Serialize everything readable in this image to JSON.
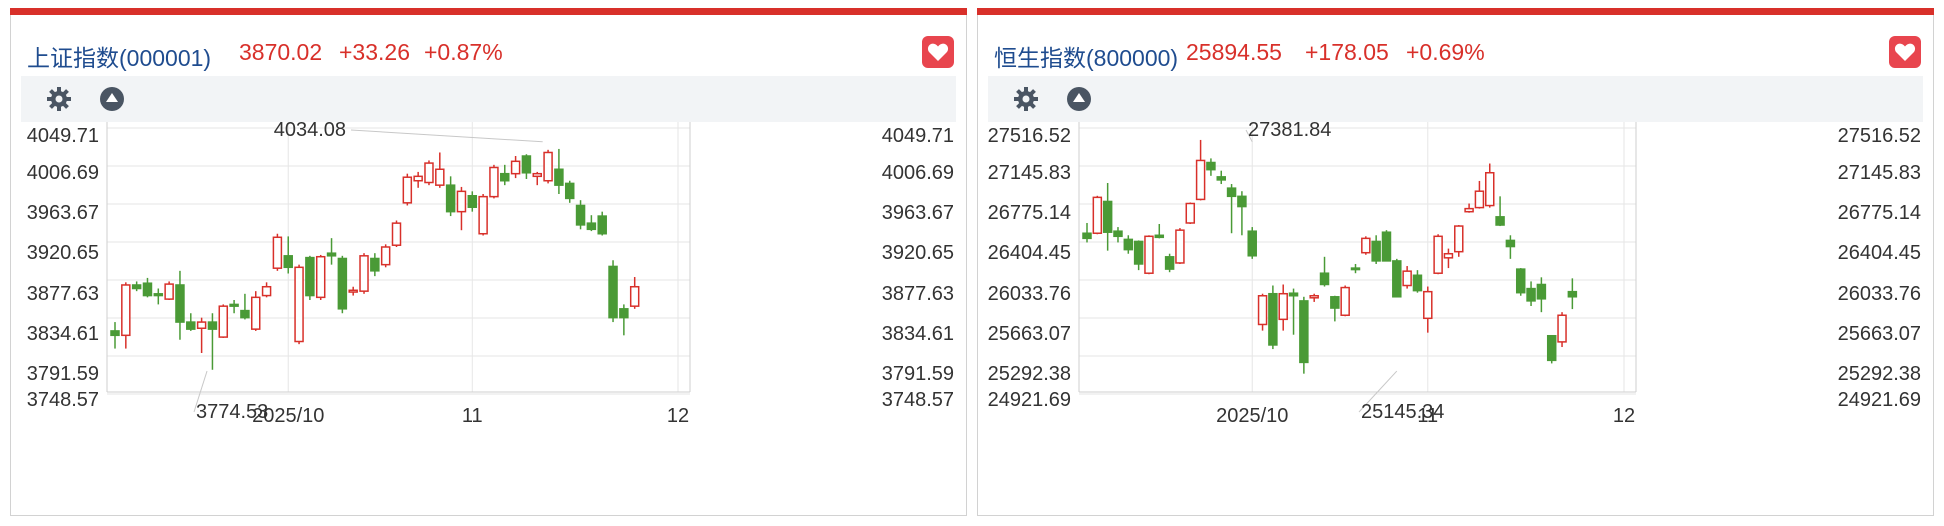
{
  "panels": [
    {
      "title": "上证指数(000001)",
      "price": "3870.02",
      "change": "+33.26",
      "change_pct": "+0.87%",
      "colors": {
        "up": "#d8302a",
        "down": "#4a9a36",
        "title": "#1f4c8f"
      },
      "icons": [
        "gear-icon",
        "triangle-up-icon",
        "heart-icon"
      ]
    },
    {
      "title": "恒生指数(800000)",
      "price": "25894.55",
      "change": "+178.05",
      "change_pct": "+0.69%",
      "colors": {
        "up": "#d8302a",
        "down": "#4a9a36",
        "title": "#1f4c8f"
      },
      "icons": [
        "gear-icon",
        "triangle-up-icon",
        "heart-icon"
      ]
    }
  ],
  "chart_data": [
    {
      "type": "candlestick",
      "ytick_labels": [
        "4049.71",
        "4006.69",
        "3963.67",
        "3920.65",
        "3877.63",
        "3834.61",
        "3791.59",
        "3748.57"
      ],
      "ylim": [
        3748.57,
        4049.71
      ],
      "xtick_labels": [
        "2025/10",
        "11",
        "12"
      ],
      "xticks": [
        16,
        33,
        52
      ],
      "xlim": [
        0,
        52
      ],
      "grid": true,
      "annotations": [
        {
          "text": "4034.08",
          "x": 39.5,
          "y": 4034.08
        },
        {
          "text": "3774.53",
          "x": 8.5,
          "y": 3774.53
        }
      ],
      "candles": [
        {
          "x": 0,
          "o": 3820,
          "h": 3830,
          "l": 3800,
          "c": 3815
        },
        {
          "x": 1,
          "o": 3815,
          "h": 3875,
          "l": 3800,
          "c": 3872
        },
        {
          "x": 2,
          "o": 3872,
          "h": 3876,
          "l": 3865,
          "c": 3868
        },
        {
          "x": 3,
          "o": 3874,
          "h": 3880,
          "l": 3858,
          "c": 3860
        },
        {
          "x": 4,
          "o": 3862,
          "h": 3868,
          "l": 3850,
          "c": 3860
        },
        {
          "x": 5,
          "o": 3856,
          "h": 3876,
          "l": 3855,
          "c": 3873
        },
        {
          "x": 6,
          "o": 3872,
          "h": 3888,
          "l": 3810,
          "c": 3830
        },
        {
          "x": 7,
          "o": 3830,
          "h": 3840,
          "l": 3820,
          "c": 3822
        },
        {
          "x": 8,
          "o": 3823,
          "h": 3835,
          "l": 3795,
          "c": 3830
        },
        {
          "x": 9,
          "o": 3830,
          "h": 3840,
          "l": 3776,
          "c": 3822
        },
        {
          "x": 10,
          "o": 3813,
          "h": 3850,
          "l": 3812,
          "c": 3848
        },
        {
          "x": 11,
          "o": 3850,
          "h": 3855,
          "l": 3840,
          "c": 3848
        },
        {
          "x": 12,
          "o": 3843,
          "h": 3862,
          "l": 3833,
          "c": 3835
        },
        {
          "x": 13,
          "o": 3822,
          "h": 3865,
          "l": 3820,
          "c": 3858
        },
        {
          "x": 14,
          "o": 3860,
          "h": 3875,
          "l": 3858,
          "c": 3870
        },
        {
          "x": 15,
          "o": 3891,
          "h": 3930,
          "l": 3888,
          "c": 3926
        },
        {
          "x": 16,
          "o": 3905,
          "h": 3927,
          "l": 3885,
          "c": 3892
        },
        {
          "x": 17,
          "o": 3808,
          "h": 3895,
          "l": 3805,
          "c": 3892
        },
        {
          "x": 18,
          "o": 3903,
          "h": 3905,
          "l": 3855,
          "c": 3860
        },
        {
          "x": 19,
          "o": 3858,
          "h": 3906,
          "l": 3855,
          "c": 3904
        },
        {
          "x": 20,
          "o": 3908,
          "h": 3925,
          "l": 3895,
          "c": 3905
        },
        {
          "x": 21,
          "o": 3902,
          "h": 3905,
          "l": 3840,
          "c": 3845
        },
        {
          "x": 22,
          "o": 3864,
          "h": 3870,
          "l": 3860,
          "c": 3866
        },
        {
          "x": 23,
          "o": 3865,
          "h": 3908,
          "l": 3862,
          "c": 3905
        },
        {
          "x": 24,
          "o": 3902,
          "h": 3908,
          "l": 3882,
          "c": 3888
        },
        {
          "x": 25,
          "o": 3895,
          "h": 3918,
          "l": 3892,
          "c": 3915
        },
        {
          "x": 26,
          "o": 3917,
          "h": 3945,
          "l": 3915,
          "c": 3942
        },
        {
          "x": 27,
          "o": 3965,
          "h": 3998,
          "l": 3962,
          "c": 3994
        },
        {
          "x": 28,
          "o": 3990,
          "h": 4000,
          "l": 3982,
          "c": 3995
        },
        {
          "x": 29,
          "o": 3988,
          "h": 4013,
          "l": 3985,
          "c": 4010
        },
        {
          "x": 30,
          "o": 3985,
          "h": 4022,
          "l": 3982,
          "c": 4003
        },
        {
          "x": 31,
          "o": 3985,
          "h": 3995,
          "l": 3950,
          "c": 3955
        },
        {
          "x": 32,
          "o": 3955,
          "h": 3983,
          "l": 3934,
          "c": 3978
        },
        {
          "x": 33,
          "o": 3973,
          "h": 3978,
          "l": 3955,
          "c": 3960
        },
        {
          "x": 34,
          "o": 3930,
          "h": 3975,
          "l": 3928,
          "c": 3972
        },
        {
          "x": 35,
          "o": 3972,
          "h": 4008,
          "l": 3970,
          "c": 4005
        },
        {
          "x": 36,
          "o": 3998,
          "h": 4008,
          "l": 3985,
          "c": 3990
        },
        {
          "x": 37,
          "o": 3998,
          "h": 4018,
          "l": 3993,
          "c": 4012
        },
        {
          "x": 38,
          "o": 4018,
          "h": 4020,
          "l": 3992,
          "c": 3999
        },
        {
          "x": 39,
          "o": 3995,
          "h": 4000,
          "l": 3985,
          "c": 3998
        },
        {
          "x": 40,
          "o": 3990,
          "h": 4025,
          "l": 3987,
          "c": 4022
        },
        {
          "x": 41,
          "o": 4003,
          "h": 4026,
          "l": 3975,
          "c": 3985
        },
        {
          "x": 42,
          "o": 3987,
          "h": 3990,
          "l": 3965,
          "c": 3970
        },
        {
          "x": 43,
          "o": 3962,
          "h": 3968,
          "l": 3935,
          "c": 3940
        },
        {
          "x": 44,
          "o": 3942,
          "h": 3951,
          "l": 3933,
          "c": 3935
        },
        {
          "x": 45,
          "o": 3950,
          "h": 3955,
          "l": 3928,
          "c": 3930
        },
        {
          "x": 46,
          "o": 3893,
          "h": 3900,
          "l": 3830,
          "c": 3835
        },
        {
          "x": 47,
          "o": 3845,
          "h": 3850,
          "l": 3815,
          "c": 3835
        },
        {
          "x": 48,
          "o": 3848,
          "h": 3881,
          "l": 3845,
          "c": 3870
        }
      ]
    },
    {
      "type": "candlestick",
      "ytick_labels": [
        "27516.52",
        "27145.83",
        "26775.14",
        "26404.45",
        "26033.76",
        "25663.07",
        "25292.38",
        "24921.69"
      ],
      "ylim": [
        24921.69,
        27516.52
      ],
      "xtick_labels": [
        "2025/10",
        "11",
        "12"
      ],
      "xticks": [
        16,
        33,
        52
      ],
      "xlim": [
        0,
        52
      ],
      "grid": true,
      "annotations": [
        {
          "text": "27381.84",
          "x": 16,
          "y": 27381.84
        },
        {
          "text": "25145.34",
          "x": 30,
          "y": 25145.34
        }
      ],
      "candles": [
        {
          "x": 0,
          "o": 26490,
          "h": 26590,
          "l": 26400,
          "c": 26440
        },
        {
          "x": 1,
          "o": 26490,
          "h": 26855,
          "l": 26480,
          "c": 26840
        },
        {
          "x": 2,
          "o": 26800,
          "h": 26980,
          "l": 26320,
          "c": 26500
        },
        {
          "x": 3,
          "o": 26510,
          "h": 26550,
          "l": 26400,
          "c": 26460
        },
        {
          "x": 4,
          "o": 26430,
          "h": 26470,
          "l": 26290,
          "c": 26330
        },
        {
          "x": 5,
          "o": 26410,
          "h": 26420,
          "l": 26130,
          "c": 26190
        },
        {
          "x": 6,
          "o": 26100,
          "h": 26470,
          "l": 26090,
          "c": 26460
        },
        {
          "x": 7,
          "o": 26470,
          "h": 26580,
          "l": 26440,
          "c": 26450
        },
        {
          "x": 8,
          "o": 26260,
          "h": 26290,
          "l": 26110,
          "c": 26140
        },
        {
          "x": 9,
          "o": 26200,
          "h": 26540,
          "l": 26190,
          "c": 26520
        },
        {
          "x": 10,
          "o": 26590,
          "h": 26790,
          "l": 26580,
          "c": 26780
        },
        {
          "x": 11,
          "o": 26820,
          "h": 27400,
          "l": 26810,
          "c": 27200
        },
        {
          "x": 12,
          "o": 27180,
          "h": 27220,
          "l": 27050,
          "c": 27110
        },
        {
          "x": 13,
          "o": 27040,
          "h": 27100,
          "l": 26970,
          "c": 27010
        },
        {
          "x": 14,
          "o": 26930,
          "h": 26970,
          "l": 26490,
          "c": 26850
        },
        {
          "x": 15,
          "o": 26850,
          "h": 26900,
          "l": 26470,
          "c": 26750
        },
        {
          "x": 16,
          "o": 26510,
          "h": 26550,
          "l": 26240,
          "c": 26270
        },
        {
          "x": 17,
          "o": 25600,
          "h": 25900,
          "l": 25540,
          "c": 25880
        },
        {
          "x": 18,
          "o": 25900,
          "h": 25980,
          "l": 25360,
          "c": 25400
        },
        {
          "x": 19,
          "o": 25650,
          "h": 25990,
          "l": 25540,
          "c": 25900
        },
        {
          "x": 20,
          "o": 25905,
          "h": 25950,
          "l": 25500,
          "c": 25880
        },
        {
          "x": 21,
          "o": 25830,
          "h": 25870,
          "l": 25120,
          "c": 25230
        },
        {
          "x": 22,
          "o": 25860,
          "h": 25900,
          "l": 25820,
          "c": 25880
        },
        {
          "x": 23,
          "o": 26100,
          "h": 26260,
          "l": 25970,
          "c": 25990
        },
        {
          "x": 24,
          "o": 25870,
          "h": 25880,
          "l": 25630,
          "c": 25760
        },
        {
          "x": 25,
          "o": 25690,
          "h": 25980,
          "l": 25680,
          "c": 25960
        },
        {
          "x": 26,
          "o": 26150,
          "h": 26190,
          "l": 26100,
          "c": 26140
        },
        {
          "x": 27,
          "o": 26300,
          "h": 26460,
          "l": 26280,
          "c": 26440
        },
        {
          "x": 28,
          "o": 26410,
          "h": 26470,
          "l": 26190,
          "c": 26220
        },
        {
          "x": 29,
          "o": 26500,
          "h": 26520,
          "l": 26220,
          "c": 26220
        },
        {
          "x": 30,
          "o": 26220,
          "h": 26240,
          "l": 25870,
          "c": 25870
        },
        {
          "x": 31,
          "o": 25980,
          "h": 26170,
          "l": 25950,
          "c": 26120
        },
        {
          "x": 32,
          "o": 26080,
          "h": 26130,
          "l": 25910,
          "c": 25930
        },
        {
          "x": 33,
          "o": 25660,
          "h": 25970,
          "l": 25520,
          "c": 25920
        },
        {
          "x": 34,
          "o": 26100,
          "h": 26480,
          "l": 26090,
          "c": 26460
        },
        {
          "x": 35,
          "o": 26250,
          "h": 26340,
          "l": 26150,
          "c": 26290
        },
        {
          "x": 36,
          "o": 26310,
          "h": 26570,
          "l": 26260,
          "c": 26560
        },
        {
          "x": 37,
          "o": 26700,
          "h": 26780,
          "l": 26690,
          "c": 26730
        },
        {
          "x": 38,
          "o": 26740,
          "h": 27000,
          "l": 26730,
          "c": 26900
        },
        {
          "x": 39,
          "o": 26760,
          "h": 27170,
          "l": 26740,
          "c": 27080
        },
        {
          "x": 40,
          "o": 26650,
          "h": 26850,
          "l": 26560,
          "c": 26570
        },
        {
          "x": 41,
          "o": 26420,
          "h": 26470,
          "l": 26240,
          "c": 26360
        },
        {
          "x": 42,
          "o": 26140,
          "h": 26150,
          "l": 25880,
          "c": 25910
        },
        {
          "x": 43,
          "o": 25950,
          "h": 26020,
          "l": 25780,
          "c": 25830
        },
        {
          "x": 44,
          "o": 25990,
          "h": 26060,
          "l": 25720,
          "c": 25850
        },
        {
          "x": 45,
          "o": 25490,
          "h": 25490,
          "l": 25220,
          "c": 25250
        },
        {
          "x": 46,
          "o": 25430,
          "h": 25720,
          "l": 25380,
          "c": 25690
        },
        {
          "x": 47,
          "o": 25920,
          "h": 26050,
          "l": 25750,
          "c": 25870
        }
      ]
    }
  ]
}
